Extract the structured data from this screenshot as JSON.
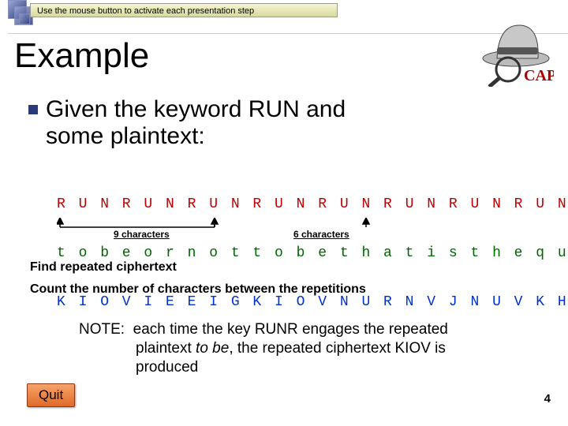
{
  "hint": "Use the mouse button to activate each presentation step",
  "logo_text": "CAP",
  "title": "Example",
  "lead": {
    "line1": "Given the keyword RUN and",
    "line2": "some plaintext:"
  },
  "cipher": {
    "key_row": "R U N R U N R U N R U N R U N R U N R U N R U N R U N",
    "plain_row": "t o b e o r n o t t o b e t h a t i s t h e q u e s t",
    "ciph_row": "K I O V I E E I G K I O V N U R N V J N U V K H V M G"
  },
  "annotations": {
    "nine": "9 characters",
    "six": "6 characters"
  },
  "instructions": {
    "a": "Find repeated ciphertext",
    "b": "Count the number of characters between the repetitions"
  },
  "note": {
    "prefix": "NOTE:",
    "line1_rest": "each time the key RUNR engages the repeated",
    "line2a": "plaintext ",
    "line2_em": "to be",
    "line2b": ", the repeated ciphertext KIOV is",
    "line3": "produced"
  },
  "quit_label": "Quit",
  "page_number": "4"
}
